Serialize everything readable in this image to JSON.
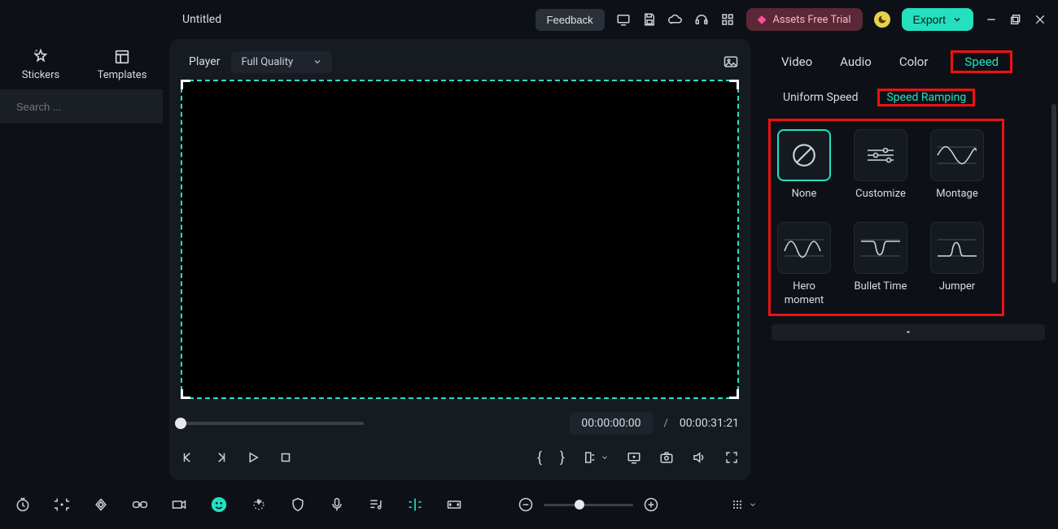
{
  "topbar": {
    "title": "Untitled",
    "feedback": "Feedback",
    "promo": "Assets Free Trial",
    "export": "Export"
  },
  "sidebar": {
    "tabs": {
      "stickers": "Stickers",
      "templates": "Templates"
    },
    "search_placeholder": "Search ..."
  },
  "player": {
    "title": "Player",
    "quality": "Full Quality",
    "time_current": "00:00:00:00",
    "time_sep": "/",
    "time_total": "00:00:31:21"
  },
  "inspector": {
    "tabs": {
      "video": "Video",
      "audio": "Audio",
      "color": "Color",
      "speed": "Speed"
    },
    "subtabs": {
      "uniform": "Uniform Speed",
      "ramping": "Speed Ramping"
    },
    "presets": {
      "none": "None",
      "customize": "Customize",
      "montage": "Montage",
      "hero": "Hero moment",
      "bullet": "Bullet Time",
      "jumper": "Jumper"
    }
  }
}
